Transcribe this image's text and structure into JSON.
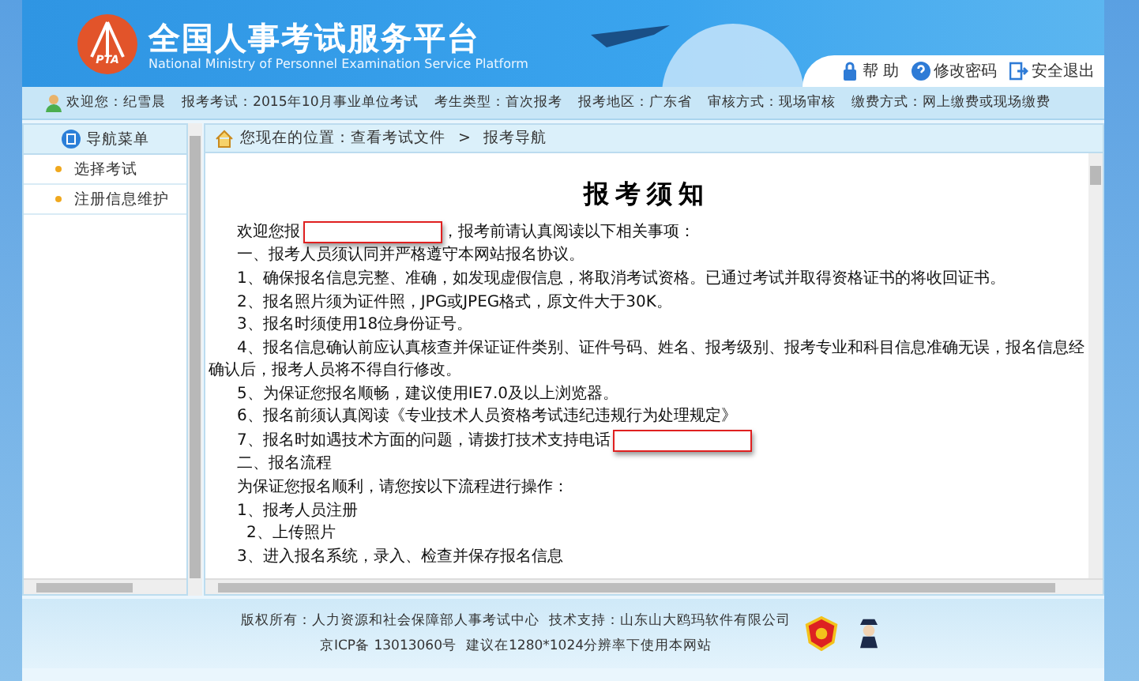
{
  "header": {
    "logo_text": "PTA",
    "title": "全国人事考试服务平台",
    "subtitle": "National Ministry of Personnel Examination Service Platform",
    "links": [
      {
        "kind": "lock",
        "label": "帮 助"
      },
      {
        "kind": "help",
        "label": "修改密码"
      },
      {
        "kind": "exit",
        "label": "安全退出"
      }
    ]
  },
  "info_bar": {
    "welcome": "欢迎您：纪雪晨",
    "items": [
      "报考考试：2015年10月事业单位考试",
      "考生类型：首次报考",
      "报考地区：广东省",
      "审核方式：现场审核",
      "缴费方式：网上缴费或现场缴费"
    ]
  },
  "sidebar": {
    "heading": "导航菜单",
    "items": [
      "选择考试",
      "注册信息维护"
    ]
  },
  "breadcrumb": {
    "path": "您现在的位置：查看考试文件",
    "separator": ">",
    "current": "报考导航"
  },
  "notice": {
    "title": "报考须知",
    "lines": [
      {
        "kind": "para",
        "text": "欢迎您报",
        "redacted": true,
        "rest": "，报考前请认真阅读以下相关事项："
      },
      {
        "kind": "para",
        "text": "一、报考人员须认同并严格遵守本网站报名协议。",
        "redacted": false
      },
      {
        "kind": "para",
        "text": "1、确保报名信息完整、准确，如发现虚假信息，将取消考试资格。已通过考试并取得资格证书的将收回证书。",
        "redacted": false
      },
      {
        "kind": "para",
        "text": "2、报名照片须为证件照，JPG或JPEG格式，原文件大于30K。",
        "redacted": false
      },
      {
        "kind": "para",
        "text": "3、报名时须使用18位身份证号。",
        "redacted": false
      },
      {
        "kind": "para",
        "text": "4、报名信息确认前应认真核查并保证证件类别、证件号码、姓名、报考级别、报考专业和科目信息准确无误，报名信息经确认后，报考人员将不得自行修改。",
        "redacted": false
      },
      {
        "kind": "para",
        "text": "5、为保证您报名顺畅，建议使用IE7.0及以上浏览器。",
        "redacted": false
      },
      {
        "kind": "para",
        "text": "6、报名前须认真阅读《专业技术人员资格考试违纪违规行为处理规定》",
        "redacted": false
      },
      {
        "kind": "para",
        "text": "7、报名时如遇技术方面的问题，请拨打技术支持电话",
        "redacted": true
      },
      {
        "kind": "para",
        "text": "二、报名流程",
        "redacted": false
      },
      {
        "kind": "para",
        "text": "为保证您报名顺利，请您按以下流程进行操作：",
        "redacted": false
      },
      {
        "kind": "para",
        "text": "1、报考人员注册",
        "redacted": false
      },
      {
        "kind": "sub",
        "text": "2、上传照片",
        "redacted": false
      },
      {
        "kind": "para",
        "text": "3、进入报名系统，录入、检查并保存报名信息",
        "redacted": false
      }
    ]
  },
  "footer": {
    "lines": [
      [
        "版权所有：人力资源和社会保障部人事考试中心",
        "技术支持：山东山大鸥玛软件有限公司"
      ],
      [
        "京ICP备 13013060号",
        "建议在1280*1024分辨率下使用本网站"
      ]
    ]
  }
}
